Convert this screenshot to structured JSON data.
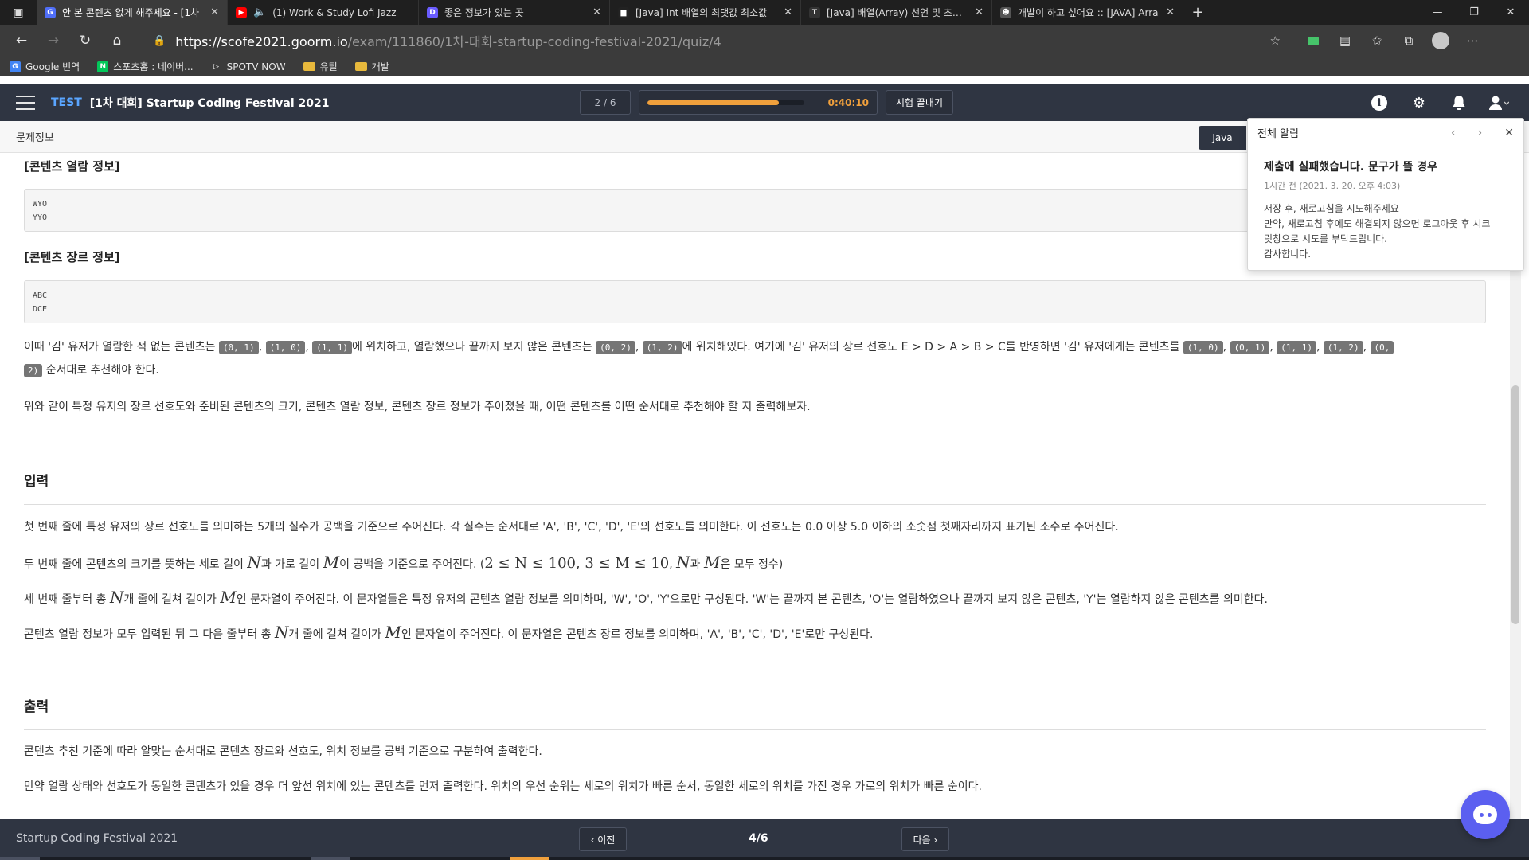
{
  "browser": {
    "tabs": [
      {
        "title": "안 본 콘텐츠 없게 해주세요 - [1차",
        "favicon_color": "#4f6ef7",
        "favicon_glyph": "G",
        "active": true
      },
      {
        "title": "(1) Work & Study Lofi Jazz",
        "favicon_color": "#ff0000",
        "favicon_glyph": "▶",
        "active": false
      },
      {
        "title": "좋은 정보가 있는 곳",
        "favicon_color": "#6a5cff",
        "favicon_glyph": "D",
        "active": false
      },
      {
        "title": "[Java] Int 배열의 최댓값 최소값",
        "favicon_color": "#222222",
        "favicon_glyph": "▆",
        "active": false
      },
      {
        "title": "[Java] 배열(Array) 선언 및 초기화",
        "favicon_color": "#333333",
        "favicon_glyph": "T",
        "active": false
      },
      {
        "title": "개발이 하고 싶어요 :: [JAVA] Arra",
        "favicon_color": "#555555",
        "favicon_glyph": "☻",
        "active": false
      }
    ],
    "url_host": "https://scofe2021.goorm.io",
    "url_path": "/exam/111860/1차-대회-startup-coding-festival-2021/quiz/4",
    "bookmarks": [
      {
        "label": "Google 번역",
        "icon_color": "#4285f4",
        "glyph": "G"
      },
      {
        "label": "스포츠홈 : 네이버...",
        "icon_color": "#03c75a",
        "glyph": "N"
      },
      {
        "label": "SPOTV NOW",
        "icon_color": "#3b3b3b",
        "glyph": "▷"
      },
      {
        "label": "유틸",
        "folder": true
      },
      {
        "label": "개발",
        "folder": true
      }
    ]
  },
  "header": {
    "tag": "TEST",
    "title": "[1차 대회] Startup Coding Festival 2021",
    "progress_label": "2 / 6",
    "timer_fraction": 0.84,
    "timer": "0:40:10",
    "end_button": "시험 끝내기"
  },
  "subbar": {
    "label": "문제정보",
    "language": "Java"
  },
  "content": {
    "view_heading": "[콘텐츠 열람 정보]",
    "view_lines": [
      "WYO",
      "YYO"
    ],
    "genre_heading": "[콘텐츠 장르 정보]",
    "genre_lines": [
      "ABC",
      "DCE"
    ],
    "p1_a": "이때 '김' 유저가 열람한 적 없는 콘텐츠는 ",
    "p1_c1": "(0, 1)",
    "p1_c2": "(1, 0)",
    "p1_c3": "(1, 1)",
    "p1_b": "에 위치하고, 열람했으나 끝까지 보지 않은 콘텐츠는 ",
    "p1_c4": "(0, 2)",
    "p1_c5": "(1, 2)",
    "p1_c": "에 위치해있다. 여기에 '김' 유저의 장르 선호도 E > D > A > B > C를 반영하면 '김' 유저에게는 콘텐츠를 ",
    "p1_r1": "(1, 0)",
    "p1_r2": "(0, 1)",
    "p1_r3": "(1, 1)",
    "p1_r4": "(1, 2)",
    "p1_r5a": "(0,",
    "p1_r5b": "2)",
    "p1_d": " 순서대로 추천해야 한다.",
    "p2": "위와 같이 특정 유저의 장르 선호도와 준비된 콘텐츠의 크기, 콘텐츠 열람 정보, 콘텐츠 장르 정보가 주어졌을 때, 어떤 콘텐츠를 어떤 순서대로 추천해야 할 지 출력해보자.",
    "input_heading": "입력",
    "in1": "첫 번째 줄에 특정 유저의 장르 선호도를 의미하는 5개의 실수가 공백을 기준으로 주어진다. 각 실수는 순서대로 'A', 'B', 'C', 'D', 'E'의 선호도를 의미한다. 이 선호도는 0.0 이상 5.0 이하의 소숫점 첫째자리까지 표기된 소수로 주어진다.",
    "in2_a": "두 번째 줄에 콘텐츠의 크기를 뜻하는 세로 길이 ",
    "in2_b": "과 가로 길이 ",
    "in2_c": "이 공백을 기준으로 주어진다. (",
    "in2_math": "2 ≤ N ≤ 100, 3 ≤ M ≤ 10",
    "in2_d": ", ",
    "in2_e": "과 ",
    "in2_f": "은 모두 정수)",
    "in3_a": "세 번째 줄부터 총 ",
    "in3_b": "개 줄에 걸쳐 길이가 ",
    "in3_c": "인 문자열이 주어진다. 이 문자열들은 특정 유저의 콘텐츠 열람 정보를 의미하며, 'W', 'O', 'Y'으로만 구성된다. 'W'는 끝까지 본 콘텐츠, 'O'는 열람하였으나 끝까지 보지 않은 콘텐츠, 'Y'는 열람하지 않은 콘텐츠를 의미한다.",
    "in4_a": "콘텐츠 열람 정보가 모두 입력된 뒤 그 다음 줄부터 총 ",
    "in4_b": "개 줄에 걸쳐 길이가 ",
    "in4_c": "인 문자열이 주어진다. 이 문자열은 콘텐츠 장르 정보를 의미하며, 'A', 'B', 'C', 'D', 'E'로만 구성된다.",
    "var_n": "N",
    "var_m": "M",
    "output_heading": "출력",
    "out1": "콘텐츠 추천 기준에 따라 알맞는 순서대로 콘텐츠 장르와 선호도, 위치 정보를 공백 기준으로 구분하여 출력한다.",
    "out2": "만약 열람 상태와 선호도가 동일한 콘텐츠가 있을 경우 더 앞선 위치에 있는 콘텐츠를 먼저 출력한다. 위치의 우선 순위는 세로의 위치가 빠른 순서, 동일한 세로의 위치를 가진 경우 가로의 위치가 빠른 순이다."
  },
  "notification": {
    "title": "전체 알림",
    "message_title": "제출에 실패했습니다. 문구가 뜰 경우",
    "time": "1시간 전 (2021. 3. 20. 오후 4:03)",
    "lines": [
      "저장 후, 새로고침을 시도해주세요",
      "만약, 새로고침 후에도 해결되지 않으면 로그아웃 후 시크",
      "릿창으로 시도를 부탁드립니다.",
      "감사합니다."
    ]
  },
  "footer": {
    "title": "Startup Coding Festival 2021",
    "prev": "‹ 이전",
    "page": "4/6",
    "next": "다음 ›"
  },
  "colors": {
    "header_bg": "#2f3542",
    "accent_blue": "#5aa5ff",
    "timer_orange": "#f0a03c",
    "chat_purple": "#5b5ff0"
  }
}
